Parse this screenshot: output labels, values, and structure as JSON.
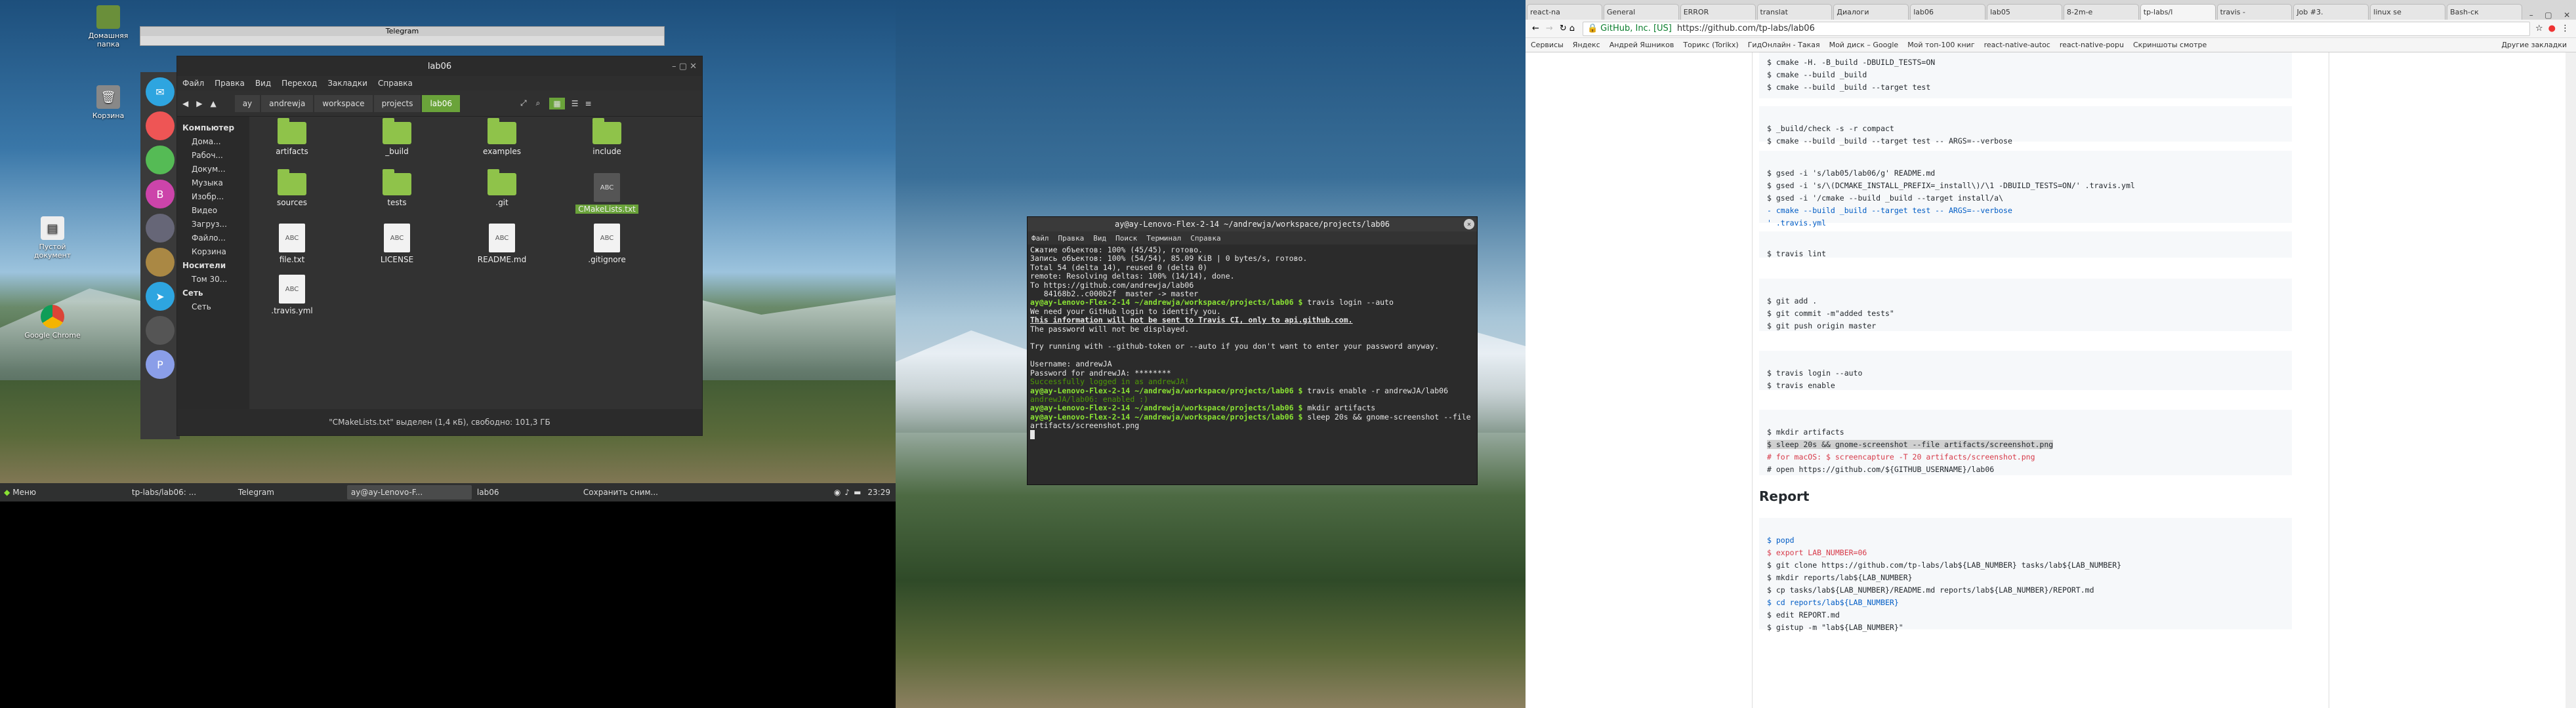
{
  "desktop": {
    "icons": [
      {
        "label": "Домашняя папка"
      },
      {
        "label": "Корзина"
      },
      {
        "label": "Пустой документ"
      },
      {
        "label": "Google Chrome"
      }
    ]
  },
  "taskbar": {
    "menu": "Меню",
    "items": [
      "tp-labs/lab06: ...",
      "Telegram",
      "ay@ay-Lenovo-F...",
      "lab06",
      "Сохранить сним..."
    ],
    "clock": "23:29"
  },
  "telegram": {
    "title": "Telegram"
  },
  "dock": {
    "avatars": [
      "B",
      "P"
    ]
  },
  "file_manager": {
    "title": "lab06",
    "menu": [
      "Файл",
      "Правка",
      "Вид",
      "Переход",
      "Закладки",
      "Справка"
    ],
    "breadcrumbs": [
      "ay",
      "andrewja",
      "workspace",
      "projects",
      "lab06"
    ],
    "sidebar": [
      {
        "label": "Компьютер",
        "header": true
      },
      {
        "label": "Дома..."
      },
      {
        "label": "Рабоч..."
      },
      {
        "label": "Докум..."
      },
      {
        "label": "Музыка"
      },
      {
        "label": "Изобр..."
      },
      {
        "label": "Видео"
      },
      {
        "label": "Загруз..."
      },
      {
        "label": "Файло..."
      },
      {
        "label": "Корзина"
      },
      {
        "label": "Носители",
        "header": true
      },
      {
        "label": "Том 30..."
      },
      {
        "label": "Сеть",
        "header": true
      },
      {
        "label": "Сеть"
      }
    ],
    "files": [
      {
        "name": "artifacts",
        "type": "folder"
      },
      {
        "name": "_build",
        "type": "folder"
      },
      {
        "name": "examples",
        "type": "folder"
      },
      {
        "name": "include",
        "type": "folder"
      },
      {
        "name": "sources",
        "type": "folder"
      },
      {
        "name": "tests",
        "type": "folder"
      },
      {
        "name": ".git",
        "type": "folder"
      },
      {
        "name": "CMakeLists.txt",
        "type": "doc",
        "selected": true
      },
      {
        "name": "file.txt",
        "type": "doc"
      },
      {
        "name": "LICENSE",
        "type": "doc"
      },
      {
        "name": "README.md",
        "type": "doc"
      },
      {
        "name": ".gitignore",
        "type": "doc"
      },
      {
        "name": ".travis.yml",
        "type": "doc"
      }
    ],
    "doc_badge": "ABC",
    "status": "\"CMakeLists.txt\" выделен (1,4 кБ), свободно: 101,3 ГБ"
  },
  "terminal": {
    "title": "ay@ay-Lenovo-Flex-2-14 ~/andrewja/workspace/projects/lab06",
    "menu": [
      "Файл",
      "Правка",
      "Вид",
      "Поиск",
      "Терминал",
      "Справка"
    ],
    "prompt": "ay@ay-Lenovo-Flex-2-14 ~/andrewja/workspace/projects/lab06 $",
    "lines": [
      "Сжатие объектов: 100% (45/45), готово.",
      "Запись объектов: 100% (54/54), 85.09 KiB | 0 bytes/s, готово.",
      "Total 54 (delta 14), reused 0 (delta 0)",
      "remote: Resolving deltas: 100% (14/14), done.",
      "To https://github.com/andrewja/lab06",
      "   84168b2..c000b2f  master -> master"
    ],
    "cmd1": "travis login --auto",
    "login_lines": [
      "We need your GitHub login to identify you.",
      "This information will not be sent to Travis CI, only to api.github.com.",
      "The password will not be displayed."
    ],
    "try_line": "Try running with --github-token or --auto if you don't want to enter your password anyway.",
    "username": "Username: andrewJA",
    "password": "Password for andrewJA: ********",
    "success": "Successfully logged in as andrewJA!",
    "cmd2": "travis enable -r andrewJA/lab06",
    "enabled": "andrewJA/lab06: enabled :)",
    "cmd3": "mkdir artifacts",
    "cmd4": "sleep 20s && gnome-screenshot --file artifacts/screenshot.png"
  },
  "browser": {
    "tabs": [
      "react-na",
      "General",
      "ERROR",
      "translat",
      "Диалоги",
      "lab06",
      "lab05",
      "8-2m-e",
      "tp-labs/l",
      "travis - ",
      "Job #3.",
      "linux se",
      "Bash-ск"
    ],
    "url_secure": "GitHub, Inc. [US]",
    "url": "https://github.com/tp-labs/lab06",
    "bookmarks": [
      "Сервисы",
      "Яндекс",
      "Андрей Яшников",
      "Торикс (Torikx)",
      "ГидОнлайн - Такая",
      "Мой диск – Google",
      "Мой топ-100 книг",
      "react-native-autoc",
      "react-native-popu",
      "Скриншоты смотре"
    ],
    "other_bookmarks": "Другие закладки",
    "blocks": [
      [
        "$ cmake -H. -B_build -DBUILD_TESTS=ON",
        "$ cmake --build _build",
        "$ cmake --build _build --target test"
      ],
      [
        "$ _build/check -s -r compact",
        "$ cmake --build _build --target test -- ARGS=--verbose"
      ],
      [
        "$ gsed -i 's/lab05/lab06/g' README.md",
        "$ gsed -i 's/\\(DCMAKE_INSTALL_PREFIX=_install\\)/\\1 -DBUILD_TESTS=ON/' .travis.yml",
        "$ gsed -i '/cmake --build _build --target install/a\\",
        "- cmake --build _build --target test -- ARGS=--verbose",
        "' .travis.yml"
      ],
      [
        "$ travis lint"
      ],
      [
        "$ git add .",
        "$ git commit -m\"added tests\"",
        "$ git push origin master"
      ],
      [
        "$ travis login --auto",
        "$ travis enable"
      ],
      [
        "$ mkdir artifacts",
        "$ sleep 20s && gnome-screenshot --file artifacts/screenshot.png",
        "# for macOS: $ screencapture -T 20 artifacts/screenshot.png",
        "# open https://github.com/${GITHUB_USERNAME}/lab06"
      ]
    ],
    "report_heading": "Report",
    "report_block": [
      "$ popd",
      "$ export LAB_NUMBER=06",
      "$ git clone https://github.com/tp-labs/lab${LAB_NUMBER} tasks/lab${LAB_NUMBER}",
      "$ mkdir reports/lab${LAB_NUMBER}",
      "$ cp tasks/lab${LAB_NUMBER}/README.md reports/lab${LAB_NUMBER}/REPORT.md",
      "$ cd reports/lab${LAB_NUMBER}",
      "$ edit REPORT.md",
      "$ gistup -m \"lab${LAB_NUMBER}\""
    ]
  }
}
